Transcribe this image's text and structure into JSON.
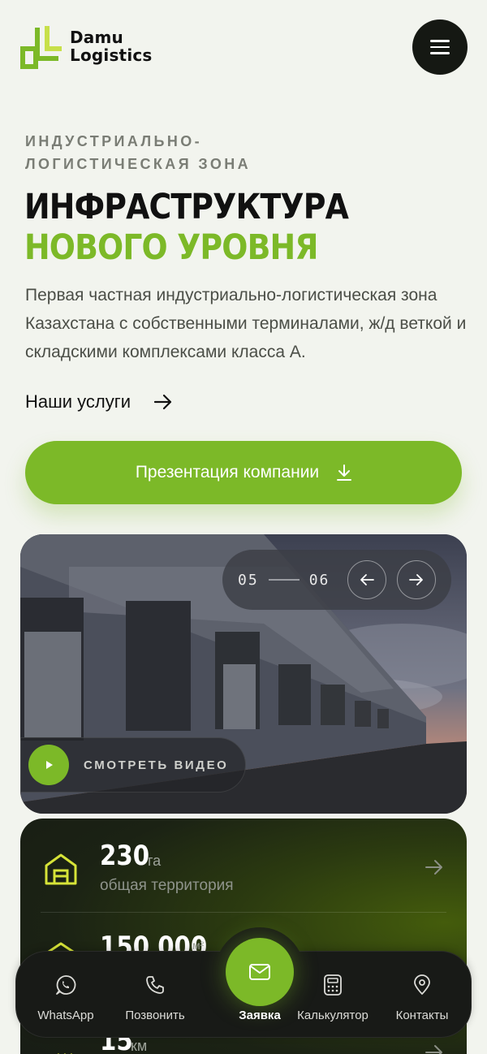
{
  "brand": {
    "name_line1": "Damu",
    "name_line2": "Logistics",
    "accent": "#7cb928",
    "logo_icon": "dl-logo-mark"
  },
  "header": {
    "menu_icon": "hamburger-icon"
  },
  "hero": {
    "eyebrow_line1": "ИНДУСТРИАЛЬНО-",
    "eyebrow_line2": "ЛОГИСТИЧЕСКАЯ ЗОНА",
    "title_line1": "ИНФРАСТРУКТУРА",
    "title_line2": "НОВОГО УРОВНЯ",
    "lead": "Первая частная индустриально-логистическая зона Казахстана с собственными терминалами, ж/д веткой и складскими комплексами класса А.",
    "services_link": "Наши услуги",
    "cta_label": "Презентация компании"
  },
  "media": {
    "current": "05",
    "total": "06",
    "video_label": "СМОТРЕТЬ ВИДЕО"
  },
  "stats": [
    {
      "value": "230",
      "unit": "га",
      "desc": "общая территория",
      "icon": "warehouse-icon"
    },
    {
      "value": "150 000",
      "unit": "м²",
      "desc": "",
      "icon": "storage-icon"
    },
    {
      "value": "15",
      "unit": "км",
      "desc": "",
      "icon": "railway-icon"
    }
  ],
  "bottom_nav": {
    "items": [
      {
        "label": "WhatsApp",
        "icon": "whatsapp-icon"
      },
      {
        "label": "Позвонить",
        "icon": "phone-icon"
      },
      {
        "label": "Заявка",
        "icon": "mail-icon"
      },
      {
        "label": "Калькулятор",
        "icon": "calculator-icon"
      },
      {
        "label": "Контакты",
        "icon": "location-pin-icon"
      }
    ]
  }
}
